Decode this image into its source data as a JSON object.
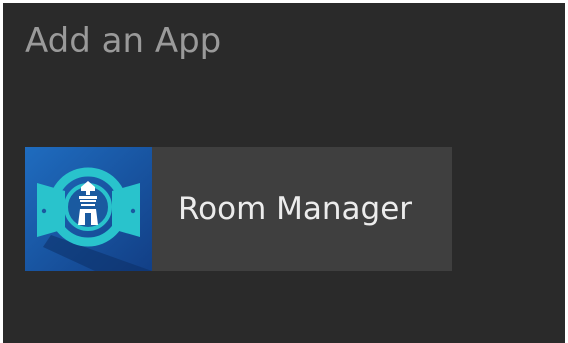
{
  "dialog": {
    "title": "Add an App"
  },
  "apps": [
    {
      "label": "Room Manager",
      "icon": "room-manager-icon"
    }
  ],
  "colors": {
    "background": "#2a2a2a",
    "tile": "#3f3f3f",
    "title_text": "#9a9a9a",
    "label_text": "#ececec",
    "icon_bg": "#1a5aa0",
    "icon_accent": "#29c3cc"
  }
}
